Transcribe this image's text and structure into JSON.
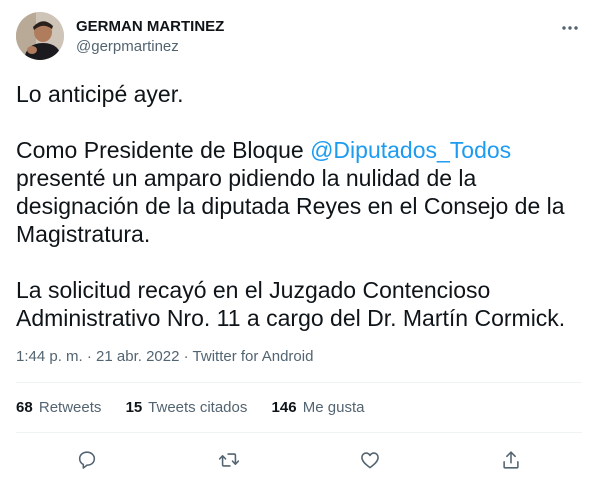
{
  "author": {
    "display_name": "GERMAN MARTINEZ",
    "handle": "@gerpmartinez"
  },
  "tweet": {
    "line1": "Lo anticipé ayer.",
    "p2_before": "Como Presidente de Bloque ",
    "p2_mention": "@Diputados_Todos",
    "p2_after": " presenté un amparo pidiendo la nulidad de la designación de la diputada Reyes en el Consejo de la Magistratura.",
    "p3": "La solicitud recayó en el Juzgado Contencioso Administrativo Nro. 11 a cargo del Dr. Martín Cormick."
  },
  "meta": {
    "time": "1:44 p. m.",
    "separator": " · ",
    "date": "21 abr. 2022",
    "source": "Twitter for Android"
  },
  "stats": {
    "retweets_count": "68",
    "retweets_label": "Retweets",
    "quotes_count": "15",
    "quotes_label": "Tweets citados",
    "likes_count": "146",
    "likes_label": "Me gusta"
  },
  "icons": {
    "more": "more-horizontal-icon",
    "reply": "reply-icon",
    "retweet": "retweet-icon",
    "like": "heart-icon",
    "share": "share-icon"
  },
  "colors": {
    "text": "#0f1419",
    "secondary": "#536471",
    "link": "#1d9bf0",
    "divider": "#eff3f4"
  }
}
